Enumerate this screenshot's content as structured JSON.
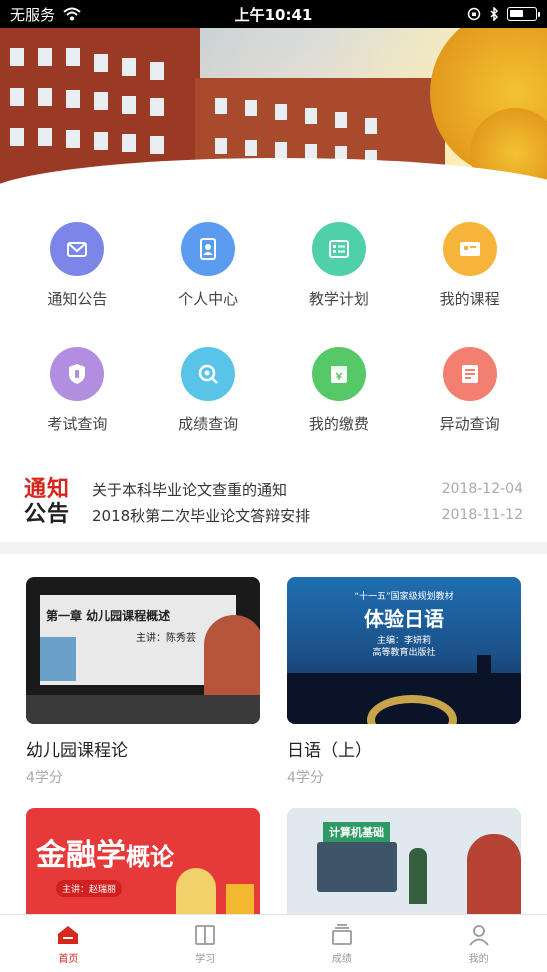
{
  "status_bar": {
    "carrier": "无服务",
    "time": "上午10:41",
    "battery_level": 0.55
  },
  "menu": {
    "row1": [
      {
        "label": "通知公告",
        "icon": "envelope-icon",
        "color": "#7b86e8"
      },
      {
        "label": "个人中心",
        "icon": "person-badge-icon",
        "color": "#5b9cf0"
      },
      {
        "label": "教学计划",
        "icon": "plan-list-icon",
        "color": "#4fd0a8"
      },
      {
        "label": "我的课程",
        "icon": "course-card-icon",
        "color": "#f7b43a"
      }
    ],
    "row2": [
      {
        "label": "考试查询",
        "icon": "exam-shield-icon",
        "color": "#b18ee0"
      },
      {
        "label": "成绩查询",
        "icon": "grade-search-icon",
        "color": "#59c4e8"
      },
      {
        "label": "我的缴费",
        "icon": "payment-icon",
        "color": "#55c867"
      },
      {
        "label": "异动查询",
        "icon": "change-record-icon",
        "color": "#f27f6f"
      }
    ]
  },
  "notices": {
    "logo_line1": "通知",
    "logo_line2": "公告",
    "items": [
      {
        "title": "关于本科毕业论文查重的通知",
        "date": "2018-12-04"
      },
      {
        "title": "2018秋第二次毕业论文答辩安排",
        "date": "2018-11-12"
      }
    ]
  },
  "courses": [
    {
      "title": "幼儿园课程论",
      "credit": "4学分",
      "thumb_heading": "第一章 幼儿园课程概述",
      "thumb_sub": "主讲：陈秀芸"
    },
    {
      "title": "日语（上）",
      "credit": "4学分",
      "thumb_top": "“十一五”国家级规划教材",
      "thumb_heading": "体验日语",
      "thumb_sub": "主编：李妍莉",
      "thumb_sub2": "高等教育出版社"
    },
    {
      "title": "金融学概论",
      "thumb_heading_a": "金融学",
      "thumb_heading_b": "概论",
      "thumb_sub": "主讲：赵瑞丽"
    },
    {
      "title": "计算机基础",
      "thumb_heading": "计算机基础"
    }
  ],
  "tabbar": [
    {
      "label": "首页",
      "icon": "home-icon",
      "active": true
    },
    {
      "label": "学习",
      "icon": "book-icon",
      "active": false
    },
    {
      "label": "成绩",
      "icon": "stack-icon",
      "active": false
    },
    {
      "label": "我的",
      "icon": "user-icon",
      "active": false
    }
  ]
}
